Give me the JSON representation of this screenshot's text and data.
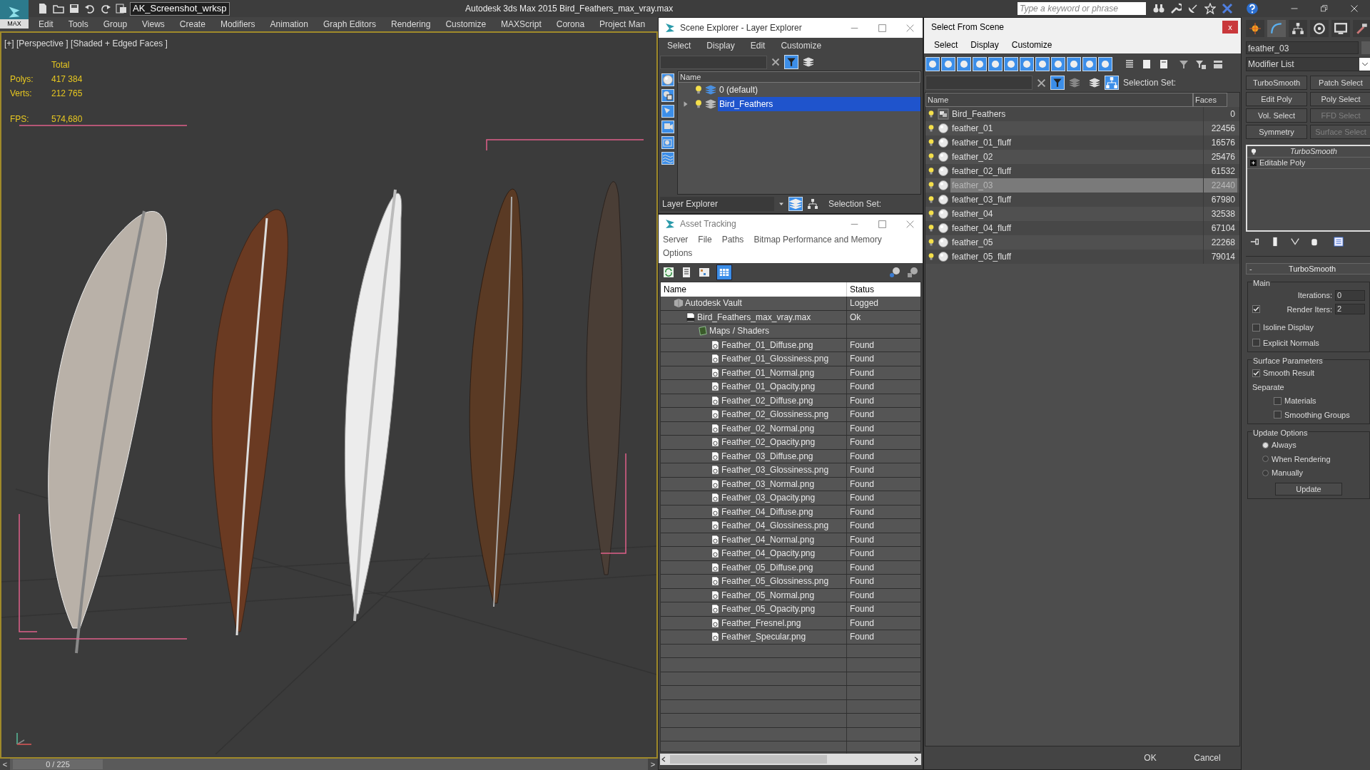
{
  "app_bar": {
    "logo_label": "MAX",
    "workspace": "AK_Screenshot_wrksp",
    "title": "Autodesk 3ds Max  2015    Bird_Feathers_max_vray.max",
    "search_placeholder": "Type a keyword or phrase"
  },
  "menu": [
    "Edit",
    "Tools",
    "Group",
    "Views",
    "Create",
    "Modifiers",
    "Animation",
    "Graph Editors",
    "Rendering",
    "Customize",
    "MAXScript",
    "Corona",
    "Project Man"
  ],
  "viewport": {
    "label": "[+] [Perspective ] [Shaded + Edged Faces ]",
    "stats_header": "Total",
    "stats": [
      {
        "label": "Polys:",
        "value": "417 384"
      },
      {
        "label": "Verts:",
        "value": "212 765"
      },
      {
        "label": "FPS:",
        "value": "574,680"
      }
    ]
  },
  "timeline": {
    "prev": "<",
    "frame": "0 / 225",
    "level": 0,
    "next": ">"
  },
  "scene_explorer": {
    "title": "Scene Explorer - Layer Explorer",
    "menu": [
      "Select",
      "Display",
      "Edit",
      "Customize"
    ],
    "column": "Name",
    "layers": [
      {
        "name": "0 (default)",
        "selected": false,
        "expandable": false
      },
      {
        "name": "Bird_Feathers",
        "selected": true,
        "expandable": true
      }
    ],
    "mode": "Layer Explorer",
    "selection_set_label": "Selection Set:"
  },
  "asset_tracking": {
    "title": "Asset Tracking",
    "menu": [
      "Server",
      "File",
      "Paths",
      "Bitmap Performance and Memory",
      "Options"
    ],
    "columns": [
      "Name",
      "Status"
    ],
    "rows": [
      {
        "kind": "vault",
        "name": "Autodesk Vault",
        "status": "Logged",
        "children": [
          {
            "kind": "file",
            "name": "Bird_Feathers_max_vray.max",
            "status": "Ok",
            "children": [
              {
                "kind": "folder",
                "name": "Maps / Shaders",
                "children": [
                  {
                    "kind": "image",
                    "name": "Feather_01_Diffuse.png",
                    "status": "Found"
                  },
                  {
                    "kind": "image",
                    "name": "Feather_01_Glossiness.png",
                    "status": "Found"
                  },
                  {
                    "kind": "image",
                    "name": "Feather_01_Normal.png",
                    "status": "Found"
                  },
                  {
                    "kind": "image",
                    "name": "Feather_01_Opacity.png",
                    "status": "Found"
                  },
                  {
                    "kind": "image",
                    "name": "Feather_02_Diffuse.png",
                    "status": "Found"
                  },
                  {
                    "kind": "image",
                    "name": "Feather_02_Glossiness.png",
                    "status": "Found"
                  },
                  {
                    "kind": "image",
                    "name": "Feather_02_Normal.png",
                    "status": "Found"
                  },
                  {
                    "kind": "image",
                    "name": "Feather_02_Opacity.png",
                    "status": "Found"
                  },
                  {
                    "kind": "image",
                    "name": "Feather_03_Diffuse.png",
                    "status": "Found"
                  },
                  {
                    "kind": "image",
                    "name": "Feather_03_Glossiness.png",
                    "status": "Found"
                  },
                  {
                    "kind": "image",
                    "name": "Feather_03_Normal.png",
                    "status": "Found"
                  },
                  {
                    "kind": "image",
                    "name": "Feather_03_Opacity.png",
                    "status": "Found"
                  },
                  {
                    "kind": "image",
                    "name": "Feather_04_Diffuse.png",
                    "status": "Found"
                  },
                  {
                    "kind": "image",
                    "name": "Feather_04_Glossiness.png",
                    "status": "Found"
                  },
                  {
                    "kind": "image",
                    "name": "Feather_04_Normal.png",
                    "status": "Found"
                  },
                  {
                    "kind": "image",
                    "name": "Feather_04_Opacity.png",
                    "status": "Found"
                  },
                  {
                    "kind": "image",
                    "name": "Feather_05_Diffuse.png",
                    "status": "Found"
                  },
                  {
                    "kind": "image",
                    "name": "Feather_05_Glossiness.png",
                    "status": "Found"
                  },
                  {
                    "kind": "image",
                    "name": "Feather_05_Normal.png",
                    "status": "Found"
                  },
                  {
                    "kind": "image",
                    "name": "Feather_05_Opacity.png",
                    "status": "Found"
                  },
                  {
                    "kind": "image",
                    "name": "Feather_Fresnel.png",
                    "status": "Found"
                  },
                  {
                    "kind": "image",
                    "name": "Feather_Specular.png",
                    "status": "Found"
                  }
                ]
              }
            ]
          }
        ]
      }
    ]
  },
  "select_from_scene": {
    "title": "Select From Scene",
    "close": "x",
    "menu": [
      "Select",
      "Display",
      "Customize"
    ],
    "selection_set_label": "Selection Set:",
    "columns": [
      "Name",
      "Faces"
    ],
    "rows": [
      {
        "kind": "group",
        "name": "Bird_Feathers",
        "faces": "0",
        "selected": false
      },
      {
        "kind": "object",
        "name": "feather_01",
        "faces": "22456",
        "selected": false
      },
      {
        "kind": "object",
        "name": "feather_01_fluff",
        "faces": "16576",
        "selected": false
      },
      {
        "kind": "object",
        "name": "feather_02",
        "faces": "25476",
        "selected": false
      },
      {
        "kind": "object",
        "name": "feather_02_fluff",
        "faces": "61532",
        "selected": false
      },
      {
        "kind": "object",
        "name": "feather_03",
        "faces": "22440",
        "selected": true
      },
      {
        "kind": "object",
        "name": "feather_03_fluff",
        "faces": "67980",
        "selected": false
      },
      {
        "kind": "object",
        "name": "feather_04",
        "faces": "32538",
        "selected": false
      },
      {
        "kind": "object",
        "name": "feather_04_fluff",
        "faces": "67104",
        "selected": false
      },
      {
        "kind": "object",
        "name": "feather_05",
        "faces": "22268",
        "selected": false
      },
      {
        "kind": "object",
        "name": "feather_05_fluff",
        "faces": "79014",
        "selected": false
      }
    ],
    "buttons": [
      "OK",
      "Cancel"
    ]
  },
  "command_panel": {
    "object_name": "feather_03",
    "modifier_list": "Modifier List",
    "modifier_buttons": [
      {
        "label": "TurboSmooth",
        "disabled": false
      },
      {
        "label": "Patch Select",
        "disabled": false
      },
      {
        "label": "Edit Poly",
        "disabled": false
      },
      {
        "label": "Poly Select",
        "disabled": false
      },
      {
        "label": "Vol. Select",
        "disabled": false
      },
      {
        "label": "FFD Select",
        "disabled": true
      },
      {
        "label": "Symmetry",
        "disabled": false
      },
      {
        "label": "Surface Select",
        "disabled": true
      }
    ],
    "stack": [
      {
        "kind": "modifier",
        "name": "TurboSmooth"
      },
      {
        "kind": "base",
        "name": "Editable Poly"
      }
    ],
    "rollout": {
      "collapse": "-",
      "title": "TurboSmooth",
      "main": {
        "title": "Main",
        "iterations_label": "Iterations:",
        "iterations": "0",
        "render_iters_label": "Render Iters:",
        "render_iters_checked": true,
        "render_iters": "2",
        "options": [
          {
            "label": "Isoline Display",
            "checked": false
          },
          {
            "label": "Explicit Normals",
            "checked": false
          }
        ]
      },
      "surface": {
        "title": "Surface Parameters",
        "smooth_result": {
          "label": "Smooth Result",
          "checked": true
        },
        "separate_label": "Separate",
        "separate": [
          {
            "label": "Materials",
            "checked": false
          },
          {
            "label": "Smoothing Groups",
            "checked": false
          }
        ]
      },
      "update": {
        "title": "Update Options",
        "options": [
          {
            "label": "Always",
            "selected": true
          },
          {
            "label": "When Rendering",
            "selected": false
          },
          {
            "label": "Manually",
            "selected": false
          }
        ],
        "button": "Update"
      }
    }
  }
}
